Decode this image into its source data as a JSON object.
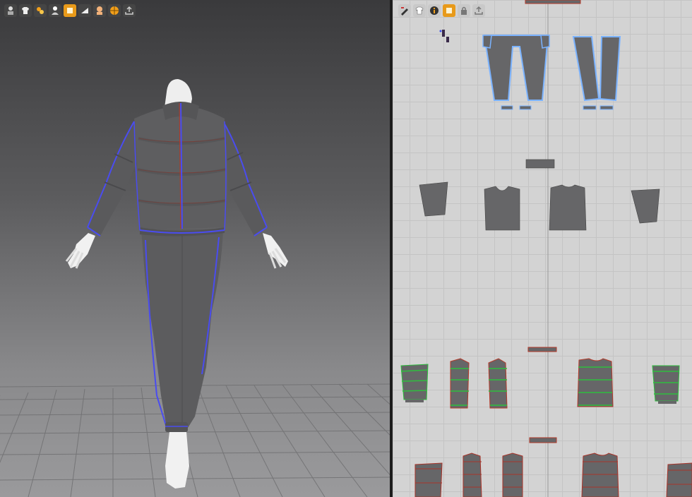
{
  "toolbar_3d": {
    "items": [
      {
        "icon": "avatar-display-icon",
        "active": false
      },
      {
        "icon": "garment-display-icon",
        "active": false
      },
      {
        "icon": "texture-icon",
        "active": false
      },
      {
        "icon": "avatar-icon",
        "active": false
      },
      {
        "icon": "pattern-icon",
        "active": true
      },
      {
        "icon": "layer-icon",
        "active": false
      },
      {
        "icon": "skin-icon",
        "active": false
      },
      {
        "icon": "globe-icon",
        "active": false
      },
      {
        "icon": "export-icon",
        "active": false
      }
    ]
  },
  "toolbar_2d": {
    "items": [
      {
        "icon": "edit-pattern-icon",
        "active": false
      },
      {
        "icon": "garment-icon",
        "active": false
      },
      {
        "icon": "info-icon",
        "active": false
      },
      {
        "icon": "pattern-icon",
        "active": true
      },
      {
        "icon": "lock-icon",
        "active": false
      },
      {
        "icon": "export-icon",
        "active": false
      }
    ]
  },
  "colors": {
    "garment": "#5a5a5c",
    "seam_blue": "#4a4cf0",
    "seam_red": "#b33a2a",
    "pattern_fill": "#666668",
    "selected_outline": "#7bb3ff",
    "stripe_green": "#2fbe3e",
    "stripe_red": "#a8342a",
    "active_tool": "#e89a1a"
  }
}
